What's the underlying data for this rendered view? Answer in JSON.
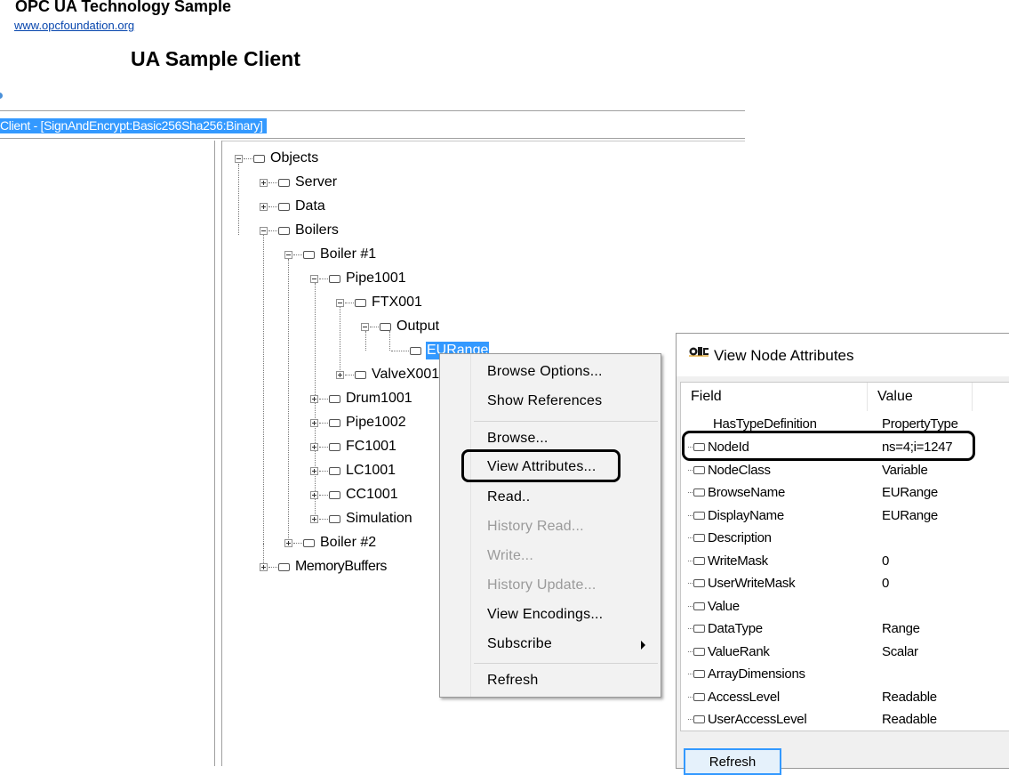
{
  "header": {
    "brand_title": "OPC UA Technology Sample",
    "brand_link": "www.opcfoundation.org",
    "app_title": "UA Sample Client"
  },
  "session": {
    "label": "Client - [SignAndEncrypt:Basic256Sha256:Binary]",
    "accent_color": "#3399ff"
  },
  "tree": {
    "nodes": [
      {
        "label": "Objects",
        "toggle": "minus"
      },
      {
        "label": "Server",
        "toggle": "plus"
      },
      {
        "label": "Data",
        "toggle": "plus"
      },
      {
        "label": "Boilers",
        "toggle": "minus"
      },
      {
        "label": "Boiler #1",
        "toggle": "minus"
      },
      {
        "label": "Pipe1001",
        "toggle": "minus"
      },
      {
        "label": "FTX001",
        "toggle": "minus"
      },
      {
        "label": "Output",
        "toggle": "minus"
      },
      {
        "label": "EURange",
        "toggle": "none",
        "selected": true
      },
      {
        "label": "ValveX001",
        "toggle": "plus"
      },
      {
        "label": "Drum1001",
        "toggle": "plus"
      },
      {
        "label": "Pipe1002",
        "toggle": "plus"
      },
      {
        "label": "FC1001",
        "toggle": "plus"
      },
      {
        "label": "LC1001",
        "toggle": "plus"
      },
      {
        "label": "CC1001",
        "toggle": "plus"
      },
      {
        "label": "Simulation",
        "toggle": "plus"
      },
      {
        "label": "Boiler #2",
        "toggle": "plus"
      },
      {
        "label": "MemoryBuffers",
        "toggle": "plus"
      }
    ]
  },
  "context_menu": {
    "items": [
      {
        "label": "Browse Options...",
        "enabled": true
      },
      {
        "label": "Show References",
        "enabled": true
      },
      {
        "label": "Browse...",
        "enabled": true
      },
      {
        "label": "View Attributes...",
        "enabled": true,
        "highlighted": true
      },
      {
        "label": "Read..",
        "enabled": true
      },
      {
        "label": "History Read...",
        "enabled": false
      },
      {
        "label": "Write...",
        "enabled": false
      },
      {
        "label": "History Update...",
        "enabled": false
      },
      {
        "label": "View Encodings...",
        "enabled": true
      },
      {
        "label": "Subscribe",
        "enabled": true,
        "submenu": true
      },
      {
        "label": "Refresh",
        "enabled": true
      }
    ]
  },
  "dialog": {
    "title": "View Node Attributes",
    "logo_icon": "opc-logo-icon",
    "columns": [
      "Field",
      "Value"
    ],
    "rows": [
      {
        "field": "HasTypeDefinition",
        "value": "PropertyType"
      },
      {
        "field": "NodeId",
        "value": "ns=4;i=1247",
        "highlighted": true
      },
      {
        "field": "NodeClass",
        "value": "Variable"
      },
      {
        "field": "BrowseName",
        "value": "EURange"
      },
      {
        "field": "DisplayName",
        "value": "EURange"
      },
      {
        "field": "Description",
        "value": ""
      },
      {
        "field": "WriteMask",
        "value": "0"
      },
      {
        "field": "UserWriteMask",
        "value": "0"
      },
      {
        "field": "Value",
        "value": ""
      },
      {
        "field": "DataType",
        "value": "Range"
      },
      {
        "field": "ValueRank",
        "value": "Scalar"
      },
      {
        "field": "ArrayDimensions",
        "value": ""
      },
      {
        "field": "AccessLevel",
        "value": "Readable"
      },
      {
        "field": "UserAccessLevel",
        "value": "Readable"
      }
    ],
    "refresh_label": "Refresh"
  }
}
